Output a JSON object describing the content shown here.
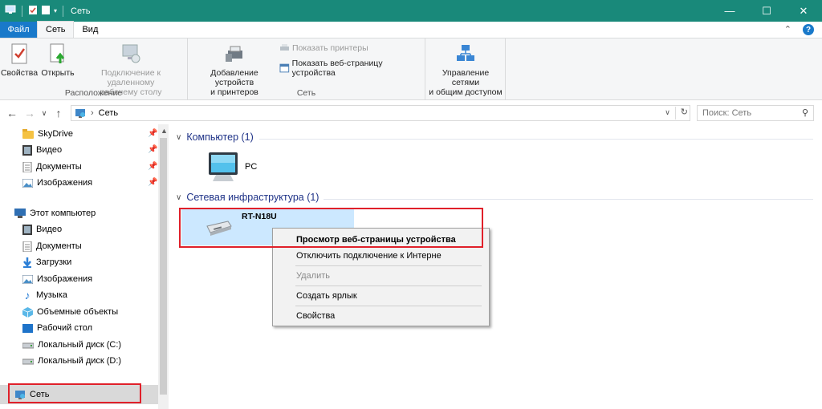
{
  "window": {
    "title": "Сеть",
    "controls": {
      "minimize": "—",
      "maximize": "☐",
      "close": "✕"
    }
  },
  "ribbon_tabs": {
    "file": "Файл",
    "network": "Сеть",
    "view": "Вид"
  },
  "ribbon": {
    "location_group": {
      "label": "Расположение",
      "properties": "Свойства",
      "open": "Открыть",
      "disconnect_line1": "Подключение к удаленному",
      "disconnect_line2": "рабочему столу"
    },
    "network_group": {
      "label": "Сеть",
      "add_devices_line1": "Добавление устройств",
      "add_devices_line2": "и принтеров",
      "show_printers": "Показать принтеры",
      "show_device_page": "Показать веб-страницу устройства"
    },
    "sharing": {
      "line1": "Управление сетями",
      "line2": "и общим доступом"
    }
  },
  "address_bar": {
    "path": "Сеть",
    "search_placeholder": "Поиск: Сеть"
  },
  "sidebar": {
    "quick_access": [
      {
        "label": "SkyDrive",
        "icon": "folder-icon"
      },
      {
        "label": "Видео",
        "icon": "video-icon"
      },
      {
        "label": "Документы",
        "icon": "documents-icon"
      },
      {
        "label": "Изображения",
        "icon": "images-icon"
      }
    ],
    "this_pc": "Этот компьютер",
    "pc_items": [
      {
        "label": "Видео",
        "icon": "video-icon"
      },
      {
        "label": "Документы",
        "icon": "documents-icon"
      },
      {
        "label": "Загрузки",
        "icon": "downloads-icon"
      },
      {
        "label": "Изображения",
        "icon": "images-icon"
      },
      {
        "label": "Музыка",
        "icon": "music-icon"
      },
      {
        "label": "Объемные объекты",
        "icon": "3d-objects-icon"
      },
      {
        "label": "Рабочий стол",
        "icon": "desktop-icon"
      },
      {
        "label": "Локальный диск (C:)",
        "icon": "drive-icon"
      },
      {
        "label": "Локальный диск (D:)",
        "icon": "drive-icon"
      }
    ],
    "network": "Сеть"
  },
  "content": {
    "group_computer": "Компьютер (1)",
    "pc_label": "PC",
    "group_infra": "Сетевая инфраструктура (1)",
    "router_label": "RT-N18U"
  },
  "context_menu": {
    "items": [
      "Просмотр веб-страницы устройства",
      "Отключить подключение к Интерне",
      "Удалить",
      "Создать ярлык",
      "Свойства"
    ]
  },
  "colors": {
    "titlebar": "#19897a",
    "file_tab": "#1979ca",
    "selection": "#cce8ff",
    "highlight": "#e0202a",
    "group_header": "#1e3287"
  }
}
